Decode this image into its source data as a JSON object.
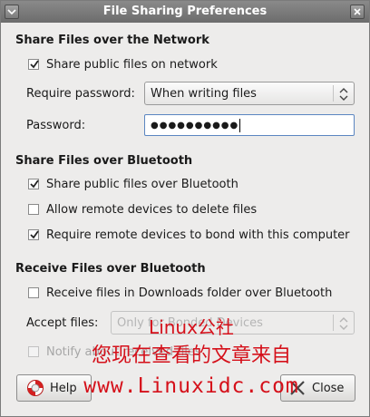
{
  "window": {
    "title": "File Sharing Preferences"
  },
  "network": {
    "section_title": "Share Files over the Network",
    "share_public_label": "Share public files on network",
    "share_public_checked": true,
    "require_password_label": "Require password:",
    "require_password_value": "When writing files",
    "password_label": "Password:",
    "password_masked": "●●●●●●●●●●"
  },
  "bluetooth_share": {
    "section_title": "Share Files over Bluetooth",
    "options": [
      {
        "label": "Share public files over Bluetooth",
        "checked": true
      },
      {
        "label": "Allow remote devices to delete files",
        "checked": false
      },
      {
        "label": "Require remote devices to bond with this computer",
        "checked": true
      }
    ]
  },
  "bluetooth_receive": {
    "section_title": "Receive Files over Bluetooth",
    "receive_label": "Receive files in Downloads folder over Bluetooth",
    "receive_checked": false,
    "accept_files_label": "Accept files:",
    "accept_files_value": "Only for Bonded Devices",
    "notify_label": "Notify about received files",
    "notify_checked": false
  },
  "buttons": {
    "help_label": "Help",
    "close_label": "Close"
  },
  "watermark": {
    "line1": "Linux公社",
    "line2": "您现在查看的文章来自",
    "line3": "www.Linuxidc.com"
  },
  "colors": {
    "titlebar": "#7a7a7a",
    "dialog_bg": "#edeceb",
    "focus_border": "#5b86c1",
    "watermark": "#d5101a"
  }
}
